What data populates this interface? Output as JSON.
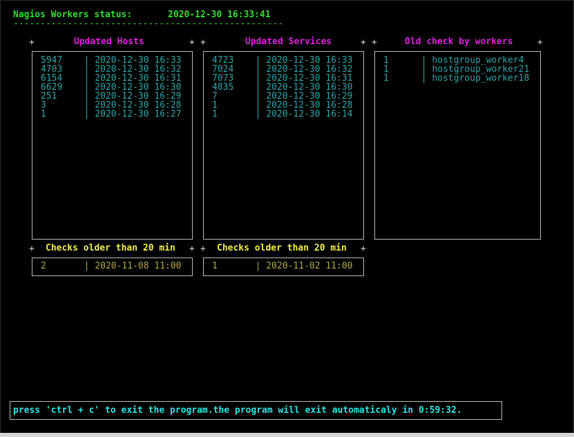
{
  "header": {
    "title": "Nagios Workers status:",
    "datetime": "2020-12-30 16:33:41",
    "separator": "--------------------------------------------------"
  },
  "panels": {
    "updated_hosts": {
      "title": "Updated Hosts",
      "rows": [
        {
          "count": "5947",
          "time": "2020-12-30 16:33"
        },
        {
          "count": "4703",
          "time": "2020-12-30 16:32"
        },
        {
          "count": "6154",
          "time": "2020-12-30 16:31"
        },
        {
          "count": "6629",
          "time": "2020-12-30 16:30"
        },
        {
          "count": "251",
          "time": "2020-12-30 16:29"
        },
        {
          "count": "3",
          "time": "2020-12-30 16:28"
        },
        {
          "count": "1",
          "time": "2020-12-30 16:27"
        }
      ]
    },
    "updated_services": {
      "title": "Updated Services",
      "rows": [
        {
          "count": "4723",
          "time": "2020-12-30 16:33"
        },
        {
          "count": "7024",
          "time": "2020-12-30 16:32"
        },
        {
          "count": "7073",
          "time": "2020-12-30 16:31"
        },
        {
          "count": "4835",
          "time": "2020-12-30 16:30"
        },
        {
          "count": "7",
          "time": "2020-12-30 16:29"
        },
        {
          "count": "1",
          "time": "2020-12-30 16:28"
        },
        {
          "count": "1",
          "time": "2020-12-30 16:14"
        }
      ]
    },
    "old_check_by_workers": {
      "title": "Old check by workers",
      "rows": [
        {
          "count": "1",
          "worker": "hostgroup_worker4"
        },
        {
          "count": "1",
          "worker": "hostgroup_worker21"
        },
        {
          "count": "1",
          "worker": "hostgroup_worker18"
        }
      ]
    },
    "old_hosts": {
      "title": "Checks older than 20 min",
      "rows": [
        {
          "count": "2",
          "time": "2020-11-08 11:00"
        }
      ]
    },
    "old_services": {
      "title": "Checks older than 20 min",
      "rows": [
        {
          "count": "1",
          "time": "2020-11-02 11:00"
        }
      ]
    }
  },
  "footer": {
    "message": "press 'ctrl + c' to exit the program.the program will exit automaticaly in 0:59:32."
  },
  "colors": {
    "background": "#000000",
    "header": "#33dd33",
    "panel_title": "#e020e0",
    "old_title": "#f0f050",
    "recent_values": "#2fa6a6",
    "old_values": "#b5a94a",
    "footer": "#2ee6e6",
    "border": "#bdbdbd"
  }
}
